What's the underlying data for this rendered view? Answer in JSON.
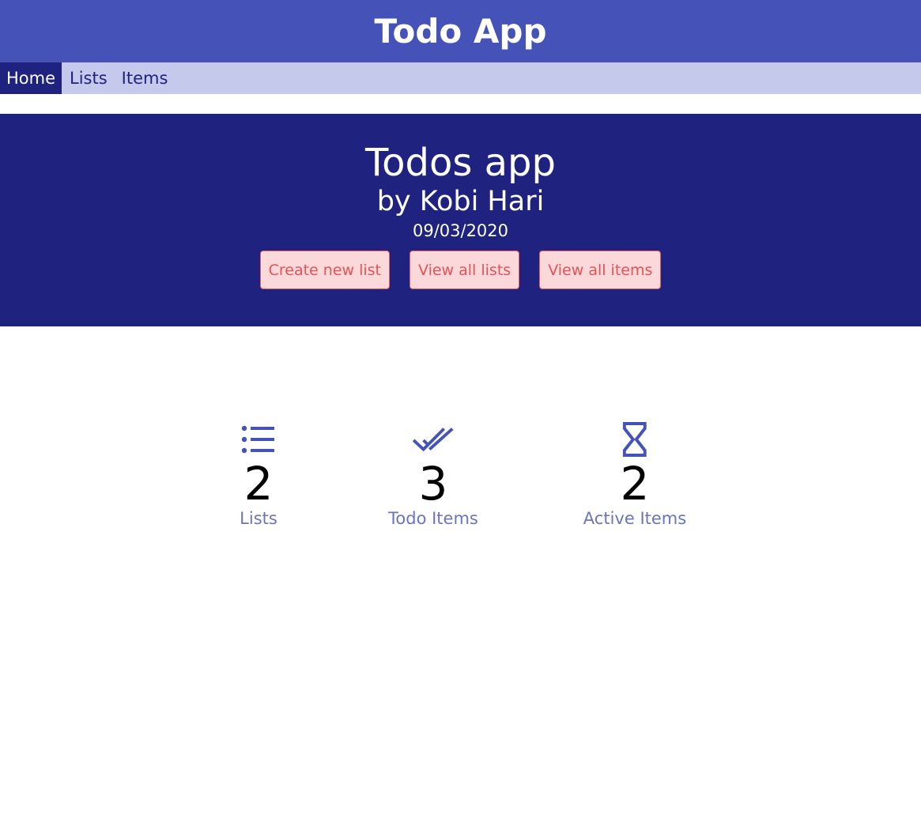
{
  "header": {
    "title": "Todo App"
  },
  "nav": {
    "items": [
      {
        "label": "Home",
        "active": true
      },
      {
        "label": "Lists",
        "active": false
      },
      {
        "label": "Items",
        "active": false
      }
    ]
  },
  "hero": {
    "title": "Todos app",
    "subtitle": "by Kobi Hari",
    "date": "09/03/2020",
    "buttons": {
      "create_list": "Create new list",
      "view_lists": "View all lists",
      "view_items": "View all items"
    }
  },
  "stats": [
    {
      "icon": "list-icon",
      "value": "2",
      "label": "Lists"
    },
    {
      "icon": "double-check-icon",
      "value": "3",
      "label": "Todo Items"
    },
    {
      "icon": "hourglass-icon",
      "value": "2",
      "label": "Active Items"
    }
  ],
  "colors": {
    "header_bg": "#4553b8",
    "nav_bg": "#c5c9eb",
    "hero_bg": "#1f237f",
    "button_bg": "#fbd9da",
    "button_text": "#e65257",
    "icon": "#4553b8",
    "stat_label": "#6b74c0"
  }
}
